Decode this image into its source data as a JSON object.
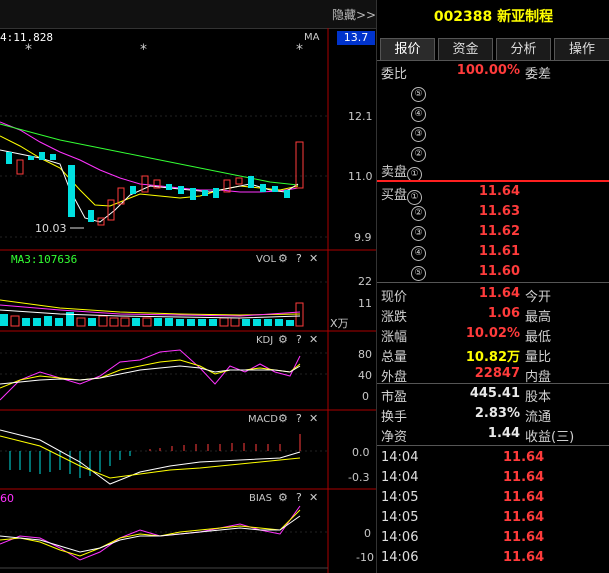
{
  "chart": {
    "hide_button": "隐藏>>",
    "ma_label": "4:11.828",
    "ma_tag": "MA",
    "price_current": "13.7",
    "price_axis": [
      "12.1",
      "11.0",
      "9.9"
    ],
    "low_marker": "10.03",
    "vol_label": "MA3:107636",
    "vol_title": "VOL",
    "vol_axis": [
      "22",
      "11",
      "X万"
    ],
    "kdj_title": "KDJ",
    "kdj_axis": [
      "80",
      "40",
      "0"
    ],
    "macd_title": "MACD",
    "macd_axis": [
      "0.0",
      "-0.3"
    ],
    "bias_title": "BIAS",
    "bias_label": "60",
    "bias_axis": [
      "0",
      "-10"
    ],
    "panel_icons": [
      "gear-icon",
      "help-icon",
      "close-icon"
    ],
    "colors": {
      "up": "#ff3b3b",
      "down": "#00e0e0",
      "ma_white": "#ffffff",
      "ma_yellow": "#ffff00",
      "ma_magenta": "#ff33ff",
      "ma_green": "#33ff33"
    }
  },
  "quote": {
    "code": "002388",
    "name": "新亚制程",
    "tabs": [
      "报价",
      "资金",
      "分析",
      "操作"
    ],
    "weibi_label": "委比",
    "weibi_value": "100.00%",
    "weicha_label": "委差",
    "sell_label": "卖盘",
    "buy_label": "买盘",
    "sell_levels": [
      "⑤",
      "④",
      "③",
      "②",
      "①"
    ],
    "buy_levels": [
      {
        "n": "①",
        "price": "11.64"
      },
      {
        "n": "②",
        "price": "11.63"
      },
      {
        "n": "③",
        "price": "11.62"
      },
      {
        "n": "④",
        "price": "11.61"
      },
      {
        "n": "⑤",
        "price": "11.60"
      }
    ],
    "stats": [
      {
        "l": "现价",
        "v": "11.64",
        "c": "red",
        "l2": "今开"
      },
      {
        "l": "涨跌",
        "v": "1.06",
        "c": "red",
        "l2": "最高"
      },
      {
        "l": "涨幅",
        "v": "10.02%",
        "c": "red",
        "l2": "最低"
      },
      {
        "l": "总量",
        "v": "10.82万",
        "c": "yel",
        "l2": "量比"
      },
      {
        "l": "外盘",
        "v": "22847",
        "c": "red",
        "l2": "内盘"
      },
      {
        "l": "市盈",
        "v": "445.41",
        "c": "wht",
        "l2": "股本"
      },
      {
        "l": "换手",
        "v": "2.83%",
        "c": "wht",
        "l2": "流通"
      },
      {
        "l": "净资",
        "v": "1.44",
        "c": "wht",
        "l2": "收益(三)"
      }
    ],
    "ticks": [
      {
        "t": "14:04",
        "p": "11.64"
      },
      {
        "t": "14:04",
        "p": "11.64"
      },
      {
        "t": "14:05",
        "p": "11.64"
      },
      {
        "t": "14:05",
        "p": "11.64"
      },
      {
        "t": "14:06",
        "p": "11.64"
      },
      {
        "t": "14:06",
        "p": "11.64"
      }
    ]
  }
}
